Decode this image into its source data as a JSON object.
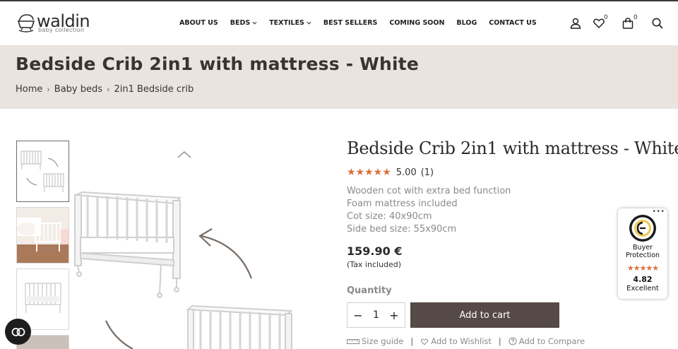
{
  "brand": {
    "name": "waldin",
    "tagline": "baby collection"
  },
  "nav": {
    "items": [
      {
        "label": "ABOUT US",
        "has_dropdown": false
      },
      {
        "label": "BEDS",
        "has_dropdown": true
      },
      {
        "label": "TEXTILES",
        "has_dropdown": true
      },
      {
        "label": "BEST SELLERS",
        "has_dropdown": false
      },
      {
        "label": "COMING SOON",
        "has_dropdown": false
      },
      {
        "label": "BLOG",
        "has_dropdown": false
      },
      {
        "label": "CONTACT US",
        "has_dropdown": false
      }
    ]
  },
  "header_icons": {
    "account": "user-icon",
    "wishlist": "heart-icon",
    "wishlist_count": "0",
    "cart": "bag-icon",
    "cart_count": "0",
    "search": "search-icon"
  },
  "page": {
    "title": "Bedside Crib 2in1 with mattress - White",
    "breadcrumb": [
      "Home",
      "Baby beds",
      "2in1 Bedside crib"
    ]
  },
  "product": {
    "title": "Bedside Crib 2in1 with mattress - White",
    "stars": "★★★★★",
    "rating": "5.00",
    "review_count": "(1)",
    "description": [
      "Wooden cot with extra bed function",
      "Foam mattress included",
      "Cot size: 40x90cm",
      "Side bed size: 55x90cm"
    ],
    "price": "159.90 €",
    "tax_note": "(Tax included)",
    "quantity_label": "Quantity",
    "quantity": "1",
    "minus": "−",
    "plus": "+",
    "add_to_cart": "Add to cart",
    "links": {
      "size_guide": "Size guide",
      "wishlist": "Add to Wishlist",
      "compare": "Add to Compare",
      "separator": "|"
    }
  },
  "trust_badge": {
    "line1": "Buyer",
    "line2": "Protection",
    "stars": "★★★★★",
    "score": "4.82",
    "label": "Excellent",
    "menu": "•••"
  },
  "colors": {
    "band_bg": "#ebe3de",
    "cart_button": "#554a45",
    "star": "#d9713b",
    "muted_text": "#8a8a8a"
  }
}
